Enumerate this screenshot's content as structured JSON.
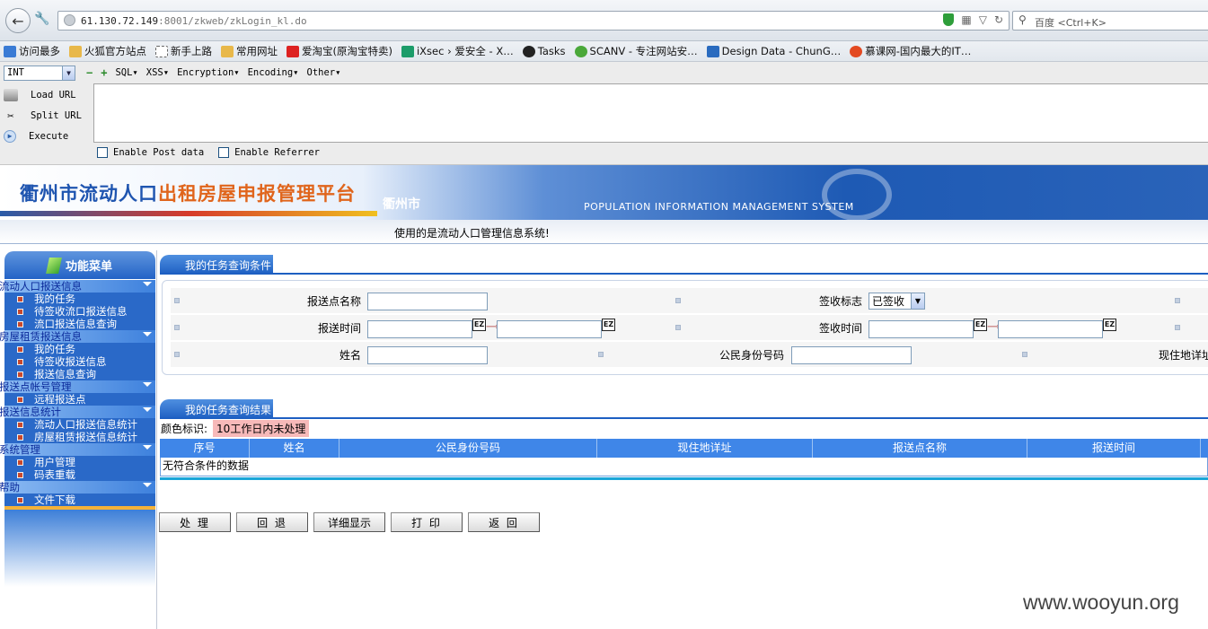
{
  "browser": {
    "url_host": "61.130.72.149",
    "url_rest": ":8001/zkweb/zkLogin_kl.do",
    "search_placeholder": "百度 <Ctrl+K>"
  },
  "bookmarks": [
    {
      "label": "访问最多",
      "icon": "gear",
      "color": "#3a7bd5"
    },
    {
      "label": "火狐官方站点",
      "icon": "folder",
      "color": "#e8b84a"
    },
    {
      "label": "新手上路",
      "icon": "dashed-box",
      "color": "#ffffff"
    },
    {
      "label": "常用网址",
      "icon": "folder",
      "color": "#e8b84a"
    },
    {
      "label": "爱淘宝(原淘宝特卖)",
      "icon": "taobao",
      "color": "#d22"
    },
    {
      "label": "iXsec › 爱安全 - X…",
      "icon": "ixsec",
      "color": "#1c9c6a"
    },
    {
      "label": "Tasks",
      "icon": "magnifier",
      "color": "#222"
    },
    {
      "label": "SCANV - 专注网站安…",
      "icon": "check-circle",
      "color": "#4aa83a"
    },
    {
      "label": "Design Data - ChunG…",
      "icon": "database",
      "color": "#2a6bbf"
    },
    {
      "label": "慕课网-国内最大的IT…",
      "icon": "flame",
      "color": "#e34a22"
    }
  ],
  "hackbar": {
    "select_value": "INT",
    "menus": [
      "SQL▾",
      "XSS▾",
      "Encryption▾",
      "Encoding▾",
      "Other▾"
    ],
    "load_url": "Load URL",
    "split_url": "Split URL",
    "execute": "Execute",
    "enable_post": "Enable Post data",
    "enable_referrer": "Enable Referrer"
  },
  "banner": {
    "title_part1": "衢州市流动人口",
    "title_part2": "出租房屋申报管理平台",
    "city": "衢州市",
    "english": "POPULATION  INFORMATION MANAGEMENT SYSTEM"
  },
  "welcome": "使用的是流动人口管理信息系统!",
  "menu": {
    "title": "功能菜单",
    "groups": [
      {
        "title": "流动人口报送信息",
        "items": [
          "我的任务",
          "待签收流口报送信息",
          "流口报送信息查询"
        ]
      },
      {
        "title": "房屋租赁报送信息",
        "items": [
          "我的任务",
          "待签收报送信息",
          "报送信息查询"
        ]
      },
      {
        "title": "报送点帐号管理",
        "items": [
          "远程报送点"
        ]
      },
      {
        "title": "报送信息统计",
        "items": [
          "流动人口报送信息统计",
          "房屋租赁报送信息统计"
        ]
      },
      {
        "title": "系统管理",
        "items": [
          "用户管理",
          "码表重载"
        ]
      },
      {
        "title": "帮助",
        "items": [
          "文件下载"
        ]
      }
    ]
  },
  "query": {
    "section_title": "我的任务查询条件",
    "lbl_site_name": "报送点名称",
    "lbl_sign_flag": "签收标志",
    "sign_flag_value": "已签收",
    "lbl_send_time": "报送时间",
    "lbl_sign_time": "签收时间",
    "lbl_name": "姓名",
    "lbl_id": "公民身份号码",
    "lbl_address": "现住地详址",
    "cal_glyph": "EZ"
  },
  "results": {
    "section_title": "我的任务查询结果",
    "legend_label": "颜色标识:",
    "legend_tag": "10工作日内未处理",
    "columns": [
      "序号",
      "姓名",
      "公民身份号码",
      "现住地详址",
      "报送点名称",
      "报送时间"
    ],
    "empty": "无符合条件的数据"
  },
  "buttons": {
    "process": "处 理",
    "back": "回 退",
    "detail": "详细显示",
    "print": "打 印",
    "return": "返 回"
  },
  "watermark": "www.wooyun.org"
}
